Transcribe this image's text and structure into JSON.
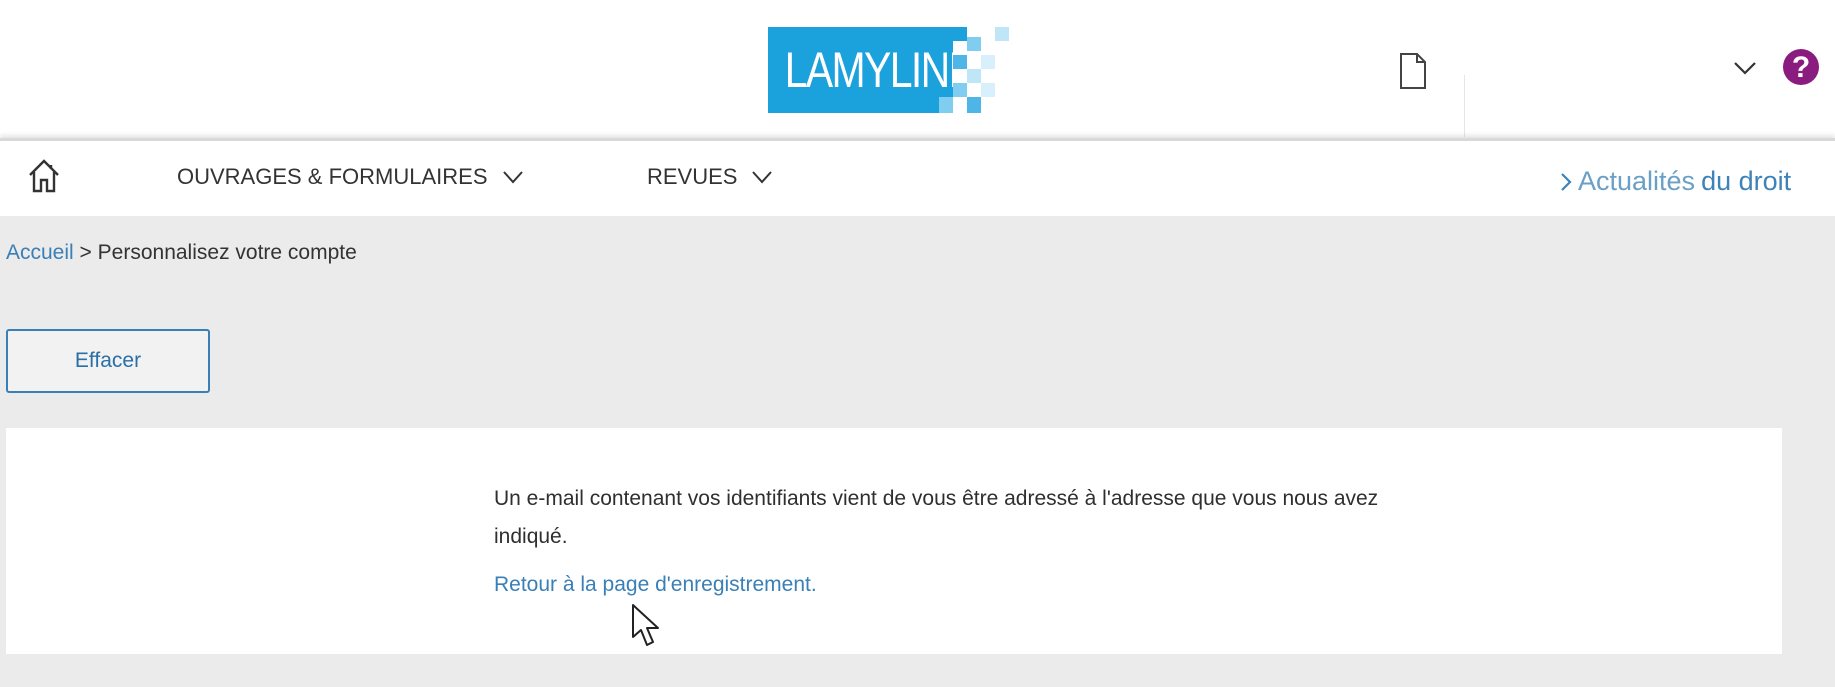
{
  "header": {
    "logo_text": "LAMYLINE",
    "brand_color": "#1ba1dc",
    "help_label": "?",
    "help_color": "#8a1c7f",
    "icons": [
      "document-icon",
      "chevron-down-icon",
      "help-icon"
    ]
  },
  "nav": {
    "items": [
      {
        "label": "OUVRAGES & FORMULAIRES"
      },
      {
        "label": "REVUES"
      }
    ],
    "news_prefix": "Actualités",
    "news_suffix": "du droit"
  },
  "breadcrumb": {
    "home": "Accueil",
    "separator": ">",
    "current": "Personnalisez votre compte"
  },
  "main": {
    "clear_button": "Effacer",
    "message": "Un e-mail contenant vos identifiants vient de vous être adressé à l'adresse que vous nous avez indiqué.",
    "return_link": "Retour à la page d'enregistrement."
  },
  "colors": {
    "link": "#3a7fb6",
    "background": "#ebebeb"
  }
}
